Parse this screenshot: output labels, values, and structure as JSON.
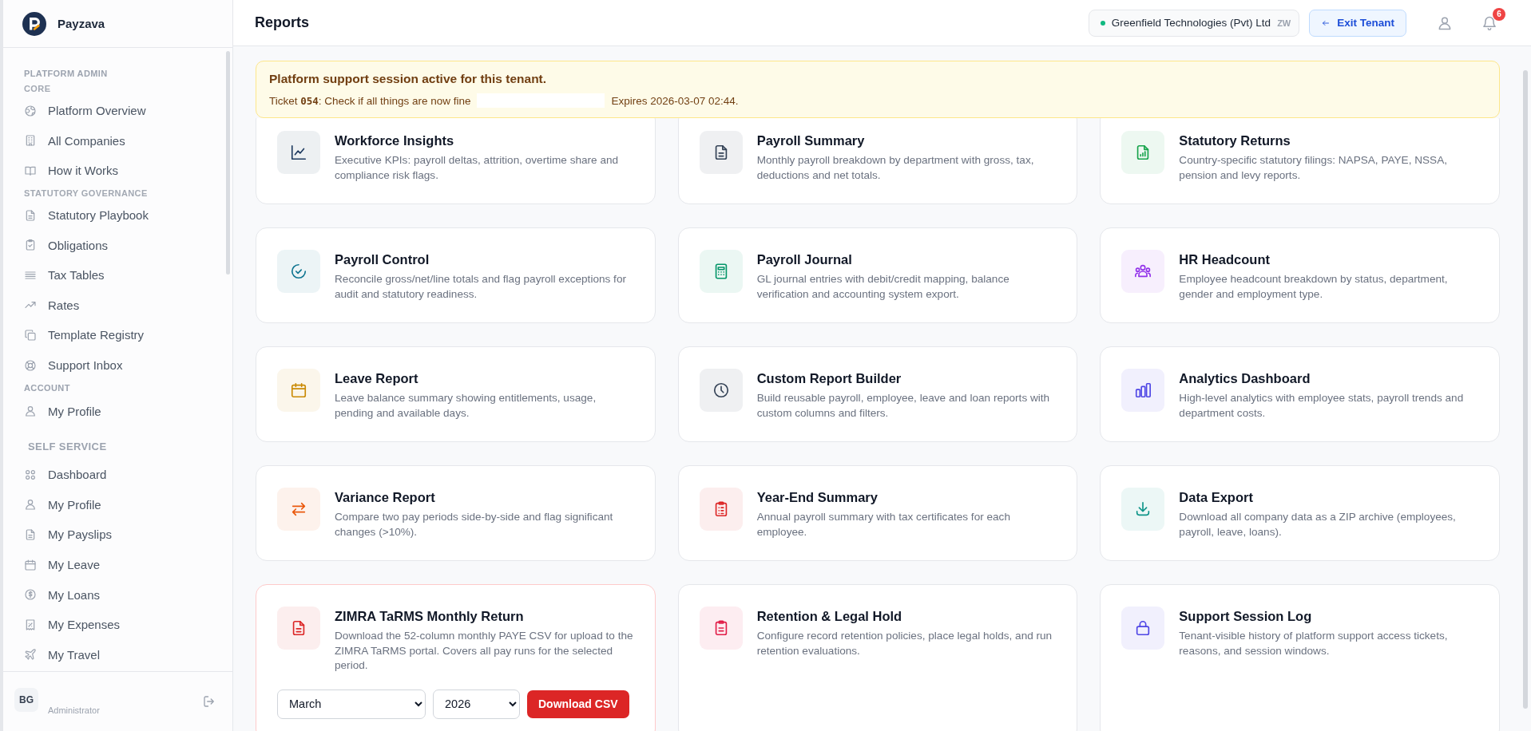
{
  "sidebar": {
    "brand": "Payzava",
    "entries": [
      {
        "kind": "group",
        "text": "PLATFORM ADMIN"
      },
      {
        "kind": "subgroup",
        "text": "CORE"
      },
      {
        "kind": "link",
        "text": "Platform Overview"
      },
      {
        "kind": "link",
        "text": "All Companies"
      },
      {
        "kind": "link",
        "text": "How it Works"
      },
      {
        "kind": "subgroup",
        "text": "STATUTORY GOVERNANCE"
      },
      {
        "kind": "link",
        "text": "Statutory Playbook"
      },
      {
        "kind": "link",
        "text": "Obligations"
      },
      {
        "kind": "link",
        "text": "Tax Tables"
      },
      {
        "kind": "link",
        "text": "Rates"
      },
      {
        "kind": "link",
        "text": "Template Registry"
      },
      {
        "kind": "link",
        "text": "Support Inbox"
      },
      {
        "kind": "group",
        "text": "ACCOUNT"
      },
      {
        "kind": "link",
        "text": "My Profile"
      },
      {
        "kind": "section",
        "text": "SELF SERVICE"
      },
      {
        "kind": "link",
        "text": "Dashboard"
      },
      {
        "kind": "link",
        "text": "My Profile"
      },
      {
        "kind": "link",
        "text": "My Payslips"
      },
      {
        "kind": "link",
        "text": "My Leave"
      },
      {
        "kind": "link",
        "text": "My Loans"
      },
      {
        "kind": "link",
        "text": "My Expenses"
      },
      {
        "kind": "link",
        "text": "My Travel"
      }
    ],
    "user": {
      "initials": "BG",
      "role": "Administrator"
    }
  },
  "header": {
    "title": "Reports",
    "tenant": {
      "name": "Greenfield Technologies (Pvt) Ltd",
      "country": "ZW"
    },
    "exit_button": "Exit Tenant",
    "notifications": "6"
  },
  "banner": {
    "title": "Platform support session active for this tenant.",
    "ticket": "Ticket **054**: Check if all things are now fine",
    "expires": "Expires 2026-03-07 02:44."
  },
  "cards": [
    {
      "kind": "link",
      "title": "Workforce Insights",
      "description": "Executive KPIs: payroll deltas, attrition, overtime share and compliance risk flags.",
      "color": "#1e3a5f"
    },
    {
      "kind": "link",
      "title": "Payroll Summary",
      "description": "Monthly payroll breakdown by department with gross, tax, deductions and net totals.",
      "color": "#334155"
    },
    {
      "kind": "link",
      "title": "Statutory Returns",
      "description": "Country-specific statutory filings: NAPSA, PAYE, NSSA, pension and levy reports.",
      "color": "#16a34a"
    },
    {
      "kind": "link",
      "title": "Payroll Control",
      "description": "Reconcile gross/net/line totals and flag payroll exceptions for audit and statutory readiness.",
      "color": "#0e7490"
    },
    {
      "kind": "link",
      "title": "Payroll Journal",
      "description": "GL journal entries with debit/credit mapping, balance verification and accounting system export.",
      "color": "#059669"
    },
    {
      "kind": "link",
      "title": "HR Headcount",
      "description": "Employee headcount breakdown by status, department, gender and employment type.",
      "color": "#9333ea"
    },
    {
      "kind": "link",
      "title": "Leave Report",
      "description": "Leave balance summary showing entitlements, usage, pending and available days.",
      "color": "#ca8a04"
    },
    {
      "kind": "link",
      "title": "Custom Report Builder",
      "description": "Build reusable payroll, employee, leave and loan reports with custom columns and filters.",
      "color": "#334155"
    },
    {
      "kind": "link",
      "title": "Analytics Dashboard",
      "description": "High-level analytics with employee stats, payroll trends and department costs.",
      "color": "#4f46e5"
    },
    {
      "kind": "link",
      "title": "Variance Report",
      "description": "Compare two pay periods side-by-side and flag significant changes (>10%).",
      "color": "#ea580c"
    },
    {
      "kind": "link",
      "title": "Year-End Summary",
      "description": "Annual payroll summary with tax certificates for each employee.",
      "color": "#dc2626"
    },
    {
      "kind": "link",
      "title": "Data Export",
      "description": "Download all company data as a ZIP archive (employees, payroll, leave, loans).",
      "color": "#0d9488"
    },
    {
      "kind": "export",
      "title": "ZIMRA TaRMS Monthly Return",
      "description": "Download the 52-column monthly PAYE CSV for upload to the ZIMRA TaRMS portal. Covers all pay runs for the selected period.",
      "color": "#dc2626",
      "month": "March",
      "year": "2026",
      "button": "Download CSV"
    },
    {
      "kind": "link",
      "title": "Retention & Legal Hold",
      "description": "Configure record retention policies, place legal holds, and run retention evaluations.",
      "color": "#e11d48"
    },
    {
      "kind": "link",
      "title": "Support Session Log",
      "description": "Tenant-visible history of platform support access tickets, reasons, and session windows.",
      "color": "#4f46e5"
    }
  ]
}
